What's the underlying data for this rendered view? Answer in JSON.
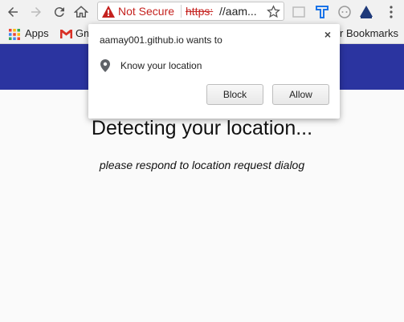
{
  "browser": {
    "security_label": "Not Secure",
    "url_scheme": "https:",
    "url_rest": "//aam..."
  },
  "bookmarks_bar": {
    "apps_label": "Apps",
    "gmail_label": "Gm",
    "other_label": "r Bookmarks"
  },
  "page": {
    "heading": "Detecting your location...",
    "subtext": "please respond to location request dialog",
    "header_color": "#2b34a0"
  },
  "permission_popup": {
    "title": "aamay001.github.io wants to",
    "permission": "Know your location",
    "block_label": "Block",
    "allow_label": "Allow",
    "close_label": "×"
  },
  "colors": {
    "warning_red": "#c5221f",
    "chrome_bg": "#f1f1f1"
  }
}
